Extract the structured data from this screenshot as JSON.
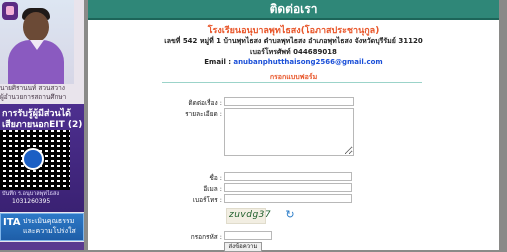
{
  "header": {
    "title": "ติดต่อเรา"
  },
  "school": {
    "name": "โรงเรียนอนุบาลพุทไธสง(โอภาสประชานุกูล)",
    "address": "เลขที่ 542 หมู่ที่ 1 บ้านพุทไธสง   ตำบลพุทไธสง  อำเภอพุทไธสง จังหวัดบุรีรัมย์ 31120",
    "phone": "เบอร์โทรศัพท์ 044689018",
    "email_label": "Email :",
    "email": "anubanphutthaisong2566@gmail.com"
  },
  "form": {
    "heading": "กรอกแบบฟอร์ม",
    "fields": {
      "contact_label": "ติดต่อเรื่อง :",
      "contact_value": "",
      "details_label": "รายละเอียด :",
      "details_value": "",
      "name_label": "ชื่อ :",
      "name_value": "",
      "email_label": "อีเมล :",
      "email_value": "",
      "phone_label": "เบอร์โทร :",
      "phone_value": "",
      "captcha_label": "กรอกรหัส :",
      "captcha_value": ""
    },
    "captcha_text": "zuvdg37",
    "submit_label": "ส่งข้อความ"
  },
  "sidebar": {
    "person_name": "นายศิรานนท์  สวนสวาง",
    "person_role": "ผู้อำนวยการสถานศึกษา",
    "banner_line1": "การรับรู้ผู้มีส่วนได้",
    "banner_line2": "เสียภายนอกEIT (2)",
    "qr_caption": "บันทึก ร.อนุบาลพุทไธสง",
    "qr_phone": "1031260395",
    "ita_logo": "ITA",
    "ita_line1": "ประเมินคุณธรรม",
    "ita_line2": "และความโปร่งใส"
  },
  "icons": {
    "refresh": "refresh-icon",
    "share": "share-icon",
    "emblem": "school-emblem-icon"
  },
  "colors": {
    "header": "#2f8778",
    "accent_orange": "#e8562a",
    "email_blue": "#1a4fd8",
    "sidebar_purple": "#4d2f8f"
  }
}
